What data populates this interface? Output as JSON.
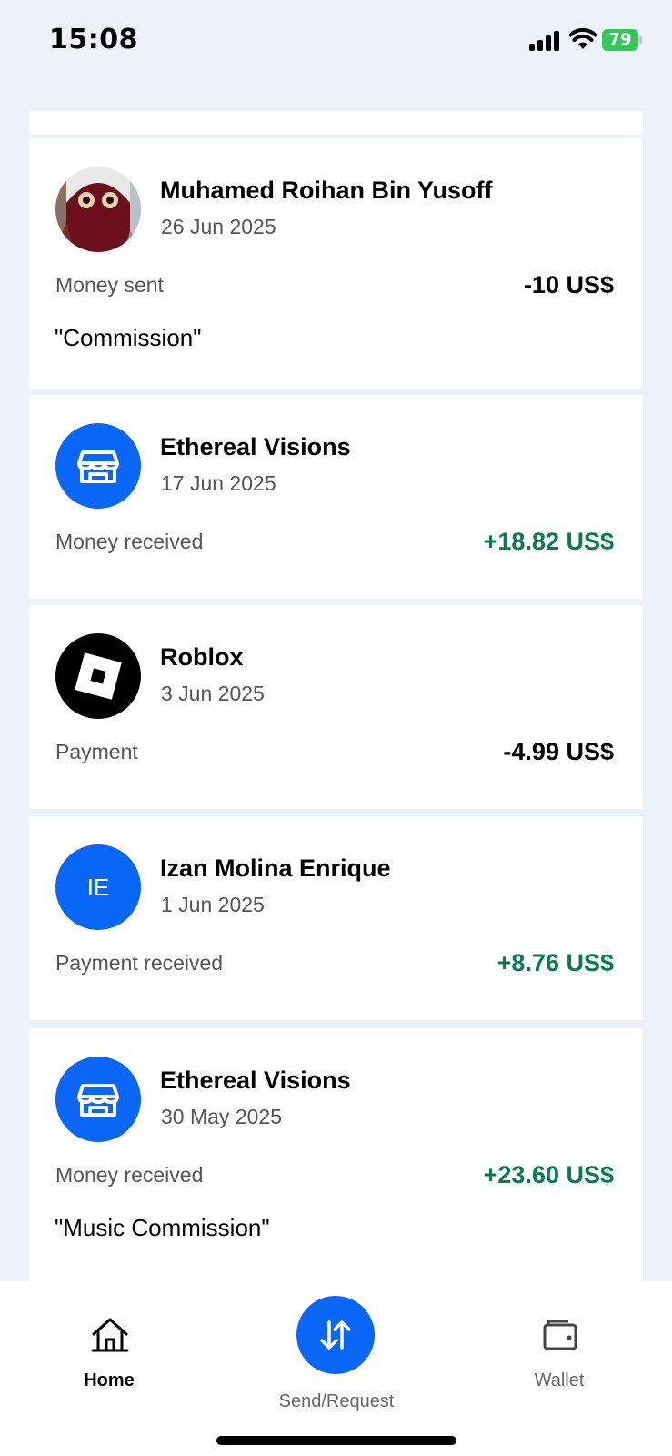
{
  "status_bar": {
    "time": "15:08",
    "battery": "79"
  },
  "transactions": [
    {
      "name": "Muhamed Roihan Bin Yusoff",
      "date": "26 Jun 2025",
      "type": "Money sent",
      "amount": "-10 US$",
      "direction": "out",
      "note": "\"Commission\"",
      "avatar": "photo"
    },
    {
      "name": "Ethereal Visions",
      "date": "17 Jun 2025",
      "type": "Money received",
      "amount": "+18.82 US$",
      "direction": "in",
      "avatar": "store-icon"
    },
    {
      "name": "Roblox",
      "date": "3 Jun 2025",
      "type": "Payment",
      "amount": "-4.99 US$",
      "direction": "out",
      "avatar": "roblox-logo"
    },
    {
      "name": "Izan Molina Enrique",
      "date": "1 Jun 2025",
      "type": "Payment received",
      "amount": "+8.76 US$",
      "direction": "in",
      "avatar": "initials",
      "initials": "IE"
    },
    {
      "name": "Ethereal Visions",
      "date": "30 May 2025",
      "type": "Money received",
      "amount": "+23.60 US$",
      "direction": "in",
      "note": "\"Music Commission\"",
      "avatar": "store-icon"
    }
  ],
  "bottom_nav": {
    "home": "Home",
    "send_request": "Send/Request",
    "wallet": "Wallet"
  },
  "colors": {
    "accent": "#0a66f5",
    "positive": "#0a7a4f",
    "background": "#ecf0f8"
  }
}
